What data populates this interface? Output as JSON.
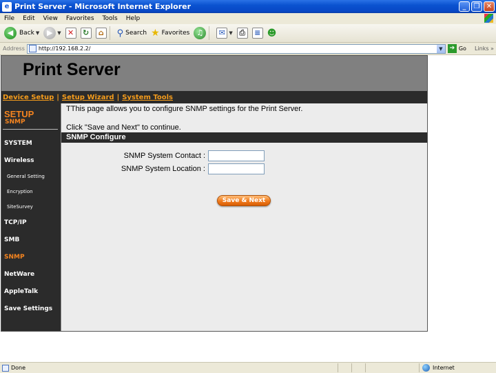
{
  "window": {
    "title": "Print Server - Microsoft Internet Explorer",
    "controls": [
      "_",
      "❐",
      "✕"
    ]
  },
  "menu": [
    "File",
    "Edit",
    "View",
    "Favorites",
    "Tools",
    "Help"
  ],
  "toolbar": {
    "back": "Back",
    "search": "Search",
    "favorites": "Favorites"
  },
  "address": {
    "label": "Address",
    "url": "http://192.168.2.2/",
    "go": "Go",
    "links": "Links"
  },
  "page": {
    "title": "Print Server",
    "nav": [
      "Device Setup",
      "Setup Wizard",
      "System Tools"
    ],
    "nav_separator": "|",
    "sidebar": {
      "heading": "SETUP",
      "subheading": "SNMP",
      "items": [
        {
          "label": "SYSTEM",
          "small": false,
          "active": false
        },
        {
          "label": "Wireless",
          "small": false,
          "active": false
        },
        {
          "label": "General Setting",
          "small": true,
          "active": false
        },
        {
          "label": "Encryption",
          "small": true,
          "active": false
        },
        {
          "label": "SiteSurvey",
          "small": true,
          "active": false
        },
        {
          "label": "TCP/IP",
          "small": false,
          "active": false
        },
        {
          "label": "SMB",
          "small": false,
          "active": false
        },
        {
          "label": "SNMP",
          "small": false,
          "active": true
        },
        {
          "label": "NetWare",
          "small": false,
          "active": false
        },
        {
          "label": "AppleTalk",
          "small": false,
          "active": false
        },
        {
          "label": "Save Settings",
          "small": false,
          "active": false
        }
      ]
    },
    "intro": "TThis page allows you to configure SNMP settings for the Print Server.",
    "instruction": "Click \"Save and Next\" to continue.",
    "section_title": "SNMP Configure",
    "fields": [
      {
        "label": "SNMP System Contact :",
        "value": ""
      },
      {
        "label": "SNMP System Location :",
        "value": ""
      }
    ],
    "save_button": "Save & Next"
  },
  "status": {
    "text": "Done",
    "zone": "Internet"
  },
  "colors": {
    "accent": "#f5841f",
    "sidebar_bg": "#2b2b2b",
    "header_bg": "#808080",
    "content_bg": "#ececec"
  }
}
